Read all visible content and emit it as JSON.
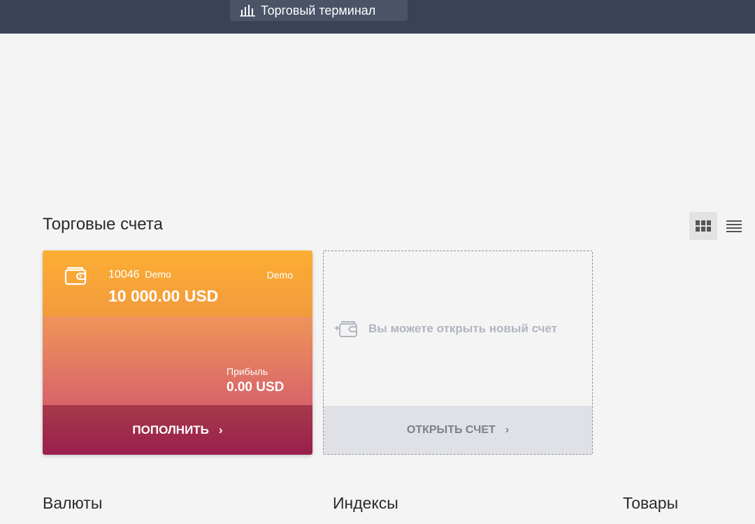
{
  "header": {
    "terminal_button": "Торговый терминал",
    "background": "#3a4356"
  },
  "accounts_section": {
    "title": "Торговые счета",
    "view_modes": [
      "grid-icon",
      "list-icon"
    ],
    "active_view": "grid"
  },
  "account_card": {
    "icon": "wallet-icon",
    "number": "10046",
    "number_tag": "Demo",
    "type": "Demo",
    "balance": "10 000.00 USD",
    "profit_label": "Прибыль",
    "profit_value": "0.00 USD",
    "deposit_button": "ПОПОЛНИТЬ",
    "chevron": "›",
    "gradient_top": "#fcae33",
    "gradient_bottom": "#9a1f4d"
  },
  "new_account_card": {
    "icon": "add-wallet-icon",
    "message": "Вы можете открыть новый счет",
    "open_button": "ОТКРЫТЬ СЧЕТ",
    "chevron": "›"
  },
  "categories": [
    "Валюты",
    "Индексы",
    "Товары"
  ]
}
